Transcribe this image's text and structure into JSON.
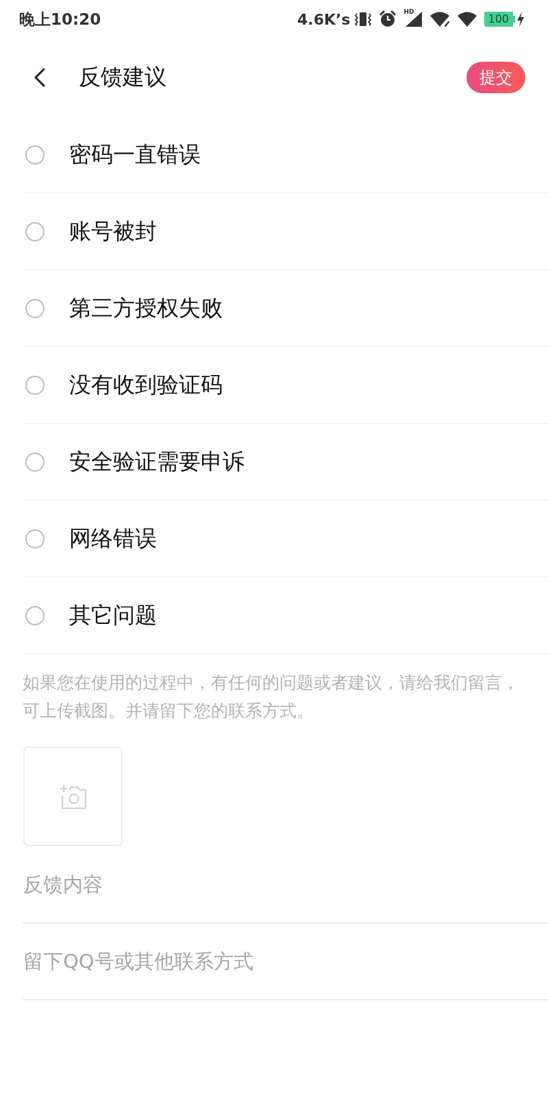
{
  "status_bar": {
    "time": "晚上10:20",
    "net_speed": "4.6K’s",
    "signal_label": "HD",
    "battery": "100",
    "charging": true
  },
  "header": {
    "title": "反馈建议",
    "submit": "提交"
  },
  "options": [
    {
      "label": "密码一直错误",
      "selected": false
    },
    {
      "label": "账号被封",
      "selected": false
    },
    {
      "label": "第三方授权失败",
      "selected": false
    },
    {
      "label": "没有收到验证码",
      "selected": false
    },
    {
      "label": "安全验证需要申诉",
      "selected": false
    },
    {
      "label": "网络错误",
      "selected": false
    },
    {
      "label": "其它问题",
      "selected": false
    }
  ],
  "hint": "如果您在使用的过程中，有任何的问题或者建议，请给我们留言，可上传截图。并请留下您的联系方式。",
  "feedback_field": {
    "placeholder": "反馈内容"
  },
  "contact_field": {
    "placeholder": "留下QQ号或其他联系方式"
  }
}
